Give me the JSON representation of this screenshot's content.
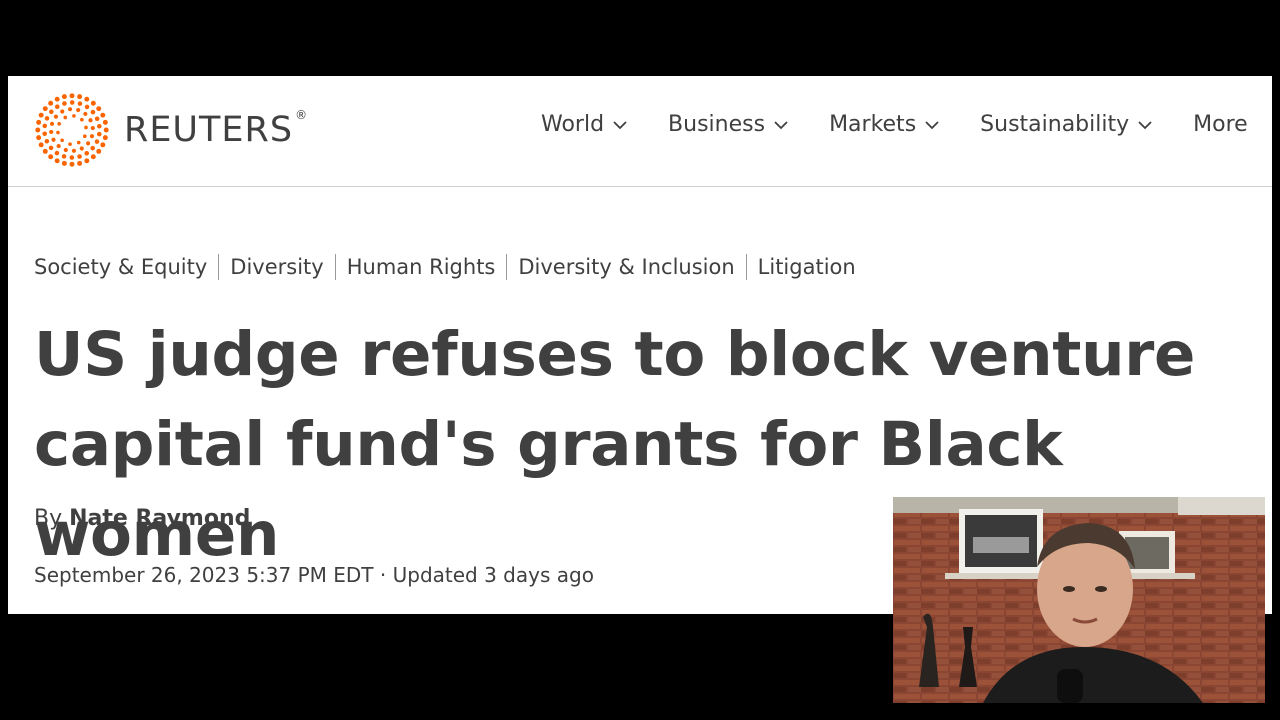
{
  "site": {
    "logo_text": "REUTERS",
    "logo_mark": "®"
  },
  "nav": {
    "items": [
      {
        "label": "World"
      },
      {
        "label": "Business"
      },
      {
        "label": "Markets"
      },
      {
        "label": "Sustainability"
      },
      {
        "label": "More"
      }
    ]
  },
  "article": {
    "tags": [
      "Society & Equity",
      "Diversity",
      "Human Rights",
      "Diversity & Inclusion",
      "Litigation"
    ],
    "headline": "US judge refuses to block venture capital fund's grants for Black women",
    "byline_prefix": "By",
    "author": "Nate Raymond",
    "date": "September 26, 2023 5:37 PM EDT",
    "separator": " · ",
    "updated": "Updated 3 days ago"
  },
  "colors": {
    "brand_orange": "#fa6400",
    "text": "#404040",
    "background": "#000000"
  }
}
